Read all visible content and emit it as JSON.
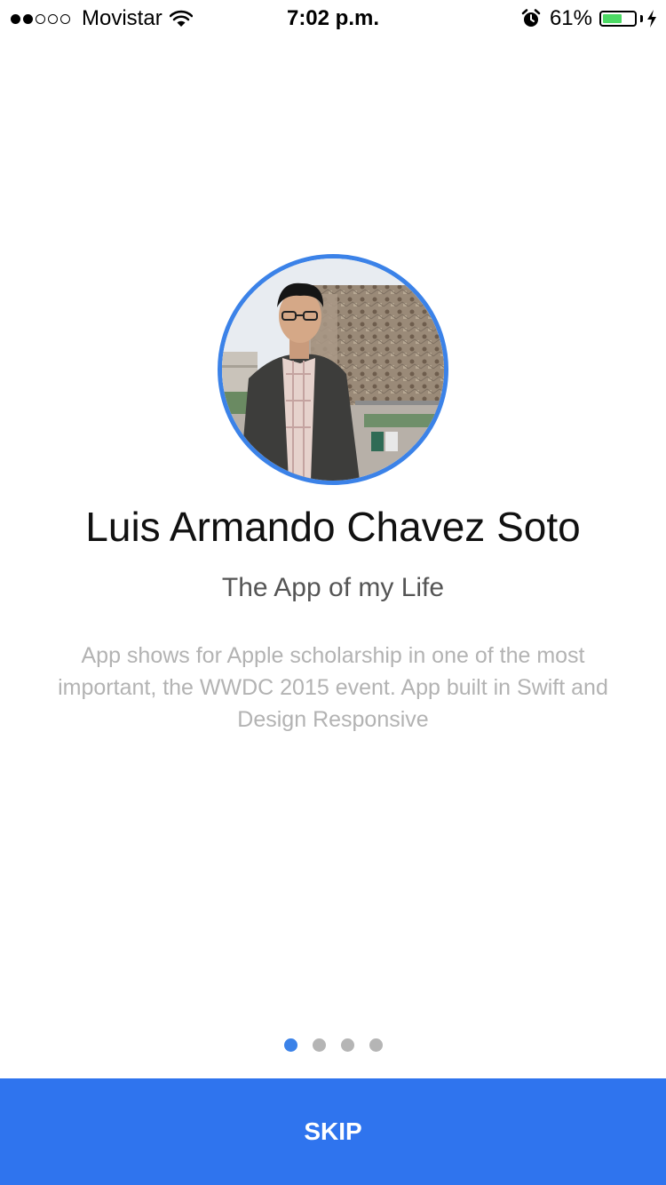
{
  "status_bar": {
    "signal_dots": [
      true,
      true,
      false,
      false,
      false
    ],
    "carrier": "Movistar",
    "time": "7:02 p.m.",
    "battery_percent_label": "61%",
    "battery_level": 0.61,
    "icons": [
      "wifi-icon",
      "alarm-icon",
      "battery-icon",
      "charging-bolt-icon"
    ]
  },
  "profile": {
    "name": "Luis Armando Chavez Soto",
    "subtitle": "The App of my Life",
    "description": "App shows for Apple scholarship in one of the most important, the WWDC 2015 event. App built in Swift and Design Responsive"
  },
  "pager": {
    "count": 4,
    "active_index": 0
  },
  "skip_button": {
    "label": "SKIP"
  },
  "colors": {
    "accent": "#2f74ee",
    "ring": "#3b82e8",
    "battery_fill": "#4cd964",
    "inactive_dot": "#b5b5b5"
  }
}
